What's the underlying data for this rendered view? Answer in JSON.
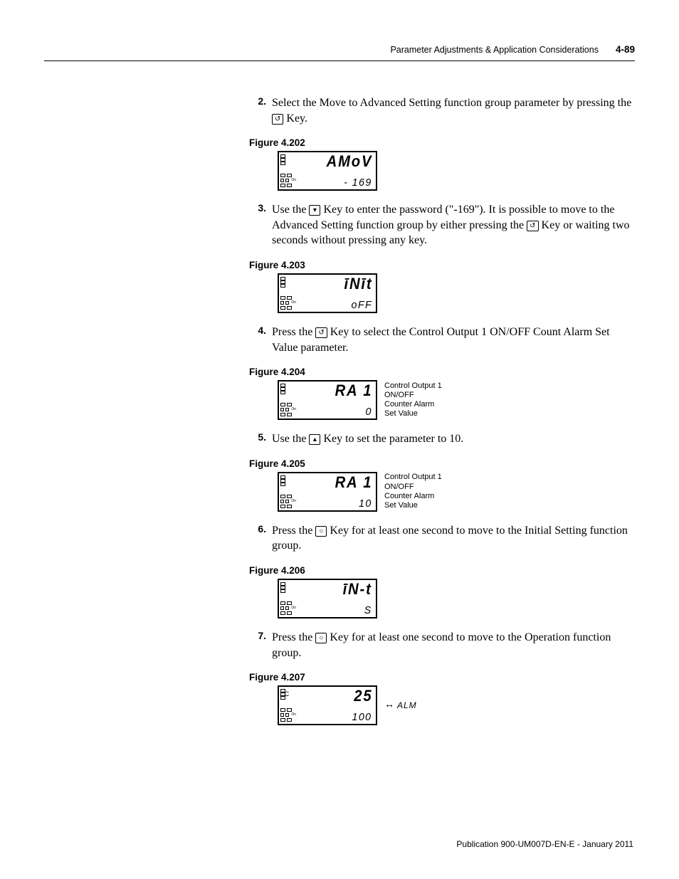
{
  "header": {
    "title": "Parameter Adjustments & Application Considerations",
    "page": "4-89"
  },
  "steps": [
    {
      "n": "2.",
      "pre": "Select the Move to Advanced Setting function group parameter by pressing the ",
      "key": "↺",
      "post": " Key."
    },
    {
      "n": "3.",
      "pre": "Use the ",
      "key": "▾",
      "post": " Key to enter the password (\"-169\"). It is possible to move to the Advanced Setting function group by either pressing the ",
      "key2": "↺",
      "post2": " Key or waiting two seconds without pressing any key."
    },
    {
      "n": "4.",
      "pre": "Press the ",
      "key": "↺",
      "post": " Key to select the Control Output 1 ON/OFF Count Alarm Set Value parameter."
    },
    {
      "n": "5.",
      "pre": "Use the ",
      "key": "▴",
      "post": " Key to set the parameter to 10."
    },
    {
      "n": "6.",
      "pre": "Press the ",
      "key": "○",
      "post": " Key for at least one second to move to the Initial Setting function group."
    },
    {
      "n": "7.",
      "pre": "Press the ",
      "key": "○",
      "post": " Key for at least one second to move to the Operation function group."
    }
  ],
  "figures": {
    "202": {
      "label": "Figure 4.202",
      "top": "AMoV",
      "bot": "- 169"
    },
    "203": {
      "label": "Figure 4.203",
      "top": "īNīt",
      "bot": "oFF"
    },
    "204": {
      "label": "Figure 4.204",
      "top": "RA 1",
      "bot": "0",
      "caption": "Control Output 1\nON/OFF\nCounter Alarm\nSet Value"
    },
    "205": {
      "label": "Figure 4.205",
      "top": "RA 1",
      "bot": "10",
      "caption": "Control Output 1\nON/OFF\nCounter Alarm\nSet Value"
    },
    "206": {
      "label": "Figure 4.206",
      "top": "īN-t",
      "bot": "S"
    },
    "207": {
      "label": "Figure 4.207",
      "top": "25",
      "bot": "100",
      "unit": "°C",
      "alm": "ALM"
    }
  },
  "footer": "Publication 900-UM007D-EN-E - January 2011"
}
